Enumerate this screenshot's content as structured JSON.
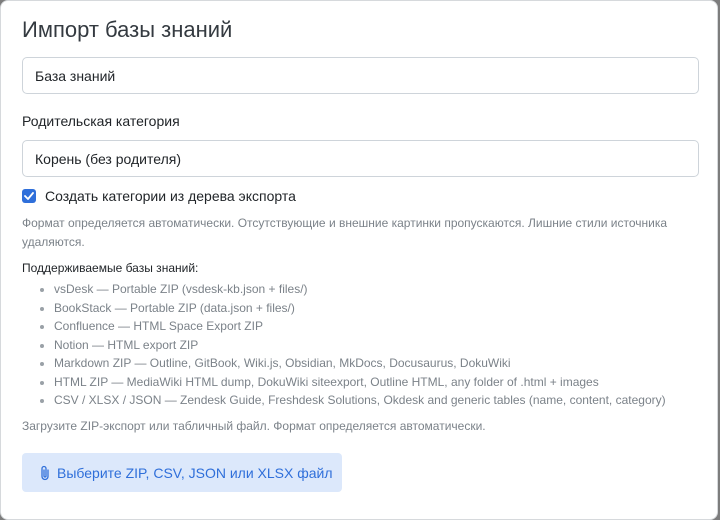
{
  "modal": {
    "title": "Импорт базы знаний",
    "name_input_value": "База знаний",
    "parent_label": "Родительская категория",
    "parent_value": "Корень (без родителя)",
    "checkbox_label": "Создать категории из дерева экспорта",
    "checkbox_checked": true,
    "hint": "Формат определяется автоматически. Отсутствующие и внешние картинки пропускаются. Лишние стили источника удаляются.",
    "supported_title": "Поддерживаемые базы знаний:",
    "supported_items": [
      "vsDesk — Portable ZIP (vsdesk-kb.json + files/)",
      "BookStack — Portable ZIP (data.json + files/)",
      "Confluence — HTML Space Export ZIP",
      "Notion — HTML export ZIP",
      "Markdown ZIP — Outline, GitBook, Wiki.js, Obsidian, MkDocs, Docusaurus, DokuWiki",
      "HTML ZIP — MediaWiki HTML dump, DokuWiki siteexport, Outline HTML, any folder of .html + images",
      "CSV / XLSX / JSON — Zendesk Guide, Freshdesk Solutions, Okdesk and generic tables (name, content, category)"
    ],
    "upload_hint": "Загрузите ZIP-экспорт или табличный файл. Формат определяется автоматически.",
    "upload_button": "Выберите ZIP, CSV, JSON или XLSX файл"
  },
  "colors": {
    "accent": "#2f6fda",
    "button_bg": "#dce8fb",
    "muted_text": "#7b8289",
    "backdrop": "#7d7d7d"
  },
  "icons": {
    "checkbox": "check-icon",
    "upload": "paperclip-icon"
  }
}
